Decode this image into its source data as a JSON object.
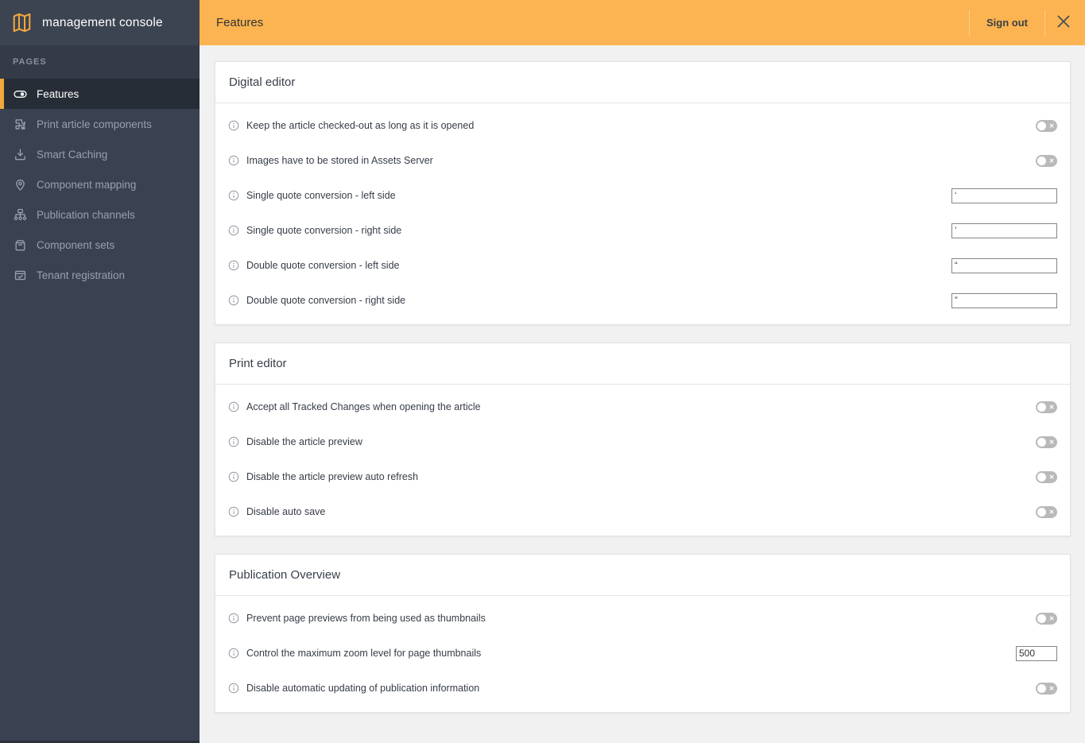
{
  "sidebar": {
    "logo_text": "management console",
    "section_label": "PAGES",
    "items": [
      {
        "label": "Features",
        "icon": "toggle-icon",
        "active": true
      },
      {
        "label": "Print article components",
        "icon": "puzzle-icon",
        "active": false
      },
      {
        "label": "Smart Caching",
        "icon": "download-icon",
        "active": false
      },
      {
        "label": "Component mapping",
        "icon": "map-pin-icon",
        "active": false
      },
      {
        "label": "Publication channels",
        "icon": "sitemap-icon",
        "active": false
      },
      {
        "label": "Component sets",
        "icon": "box-icon",
        "active": false
      },
      {
        "label": "Tenant registration",
        "icon": "server-check-icon",
        "active": false
      }
    ]
  },
  "header": {
    "title": "Features",
    "signout_label": "Sign out"
  },
  "colors": {
    "accent_orange": "#fbb451",
    "active_border_orange": "#f0a83d",
    "sidebar_bg": "#3a4150",
    "sidebar_active_bg": "#272d37",
    "toggle_off_gray": "#b9b9b9",
    "main_bg": "#f1f1f1"
  },
  "sections": [
    {
      "title": "Digital editor",
      "rows": [
        {
          "label": "Keep the article checked-out as long as it is opened",
          "control": "toggle",
          "state": "off"
        },
        {
          "label": "Images have to be stored in Assets Server",
          "control": "toggle",
          "state": "off"
        },
        {
          "label": "Single quote conversion - left side",
          "control": "text",
          "value": "‘"
        },
        {
          "label": "Single quote conversion - right side",
          "control": "text",
          "value": "’"
        },
        {
          "label": "Double quote conversion - left side",
          "control": "text",
          "value": "“"
        },
        {
          "label": "Double quote conversion - right side",
          "control": "text",
          "value": "”"
        }
      ]
    },
    {
      "title": "Print editor",
      "rows": [
        {
          "label": "Accept all Tracked Changes when opening the article",
          "control": "toggle",
          "state": "off"
        },
        {
          "label": "Disable the article preview",
          "control": "toggle",
          "state": "off"
        },
        {
          "label": "Disable the article preview auto refresh",
          "control": "toggle",
          "state": "off"
        },
        {
          "label": "Disable auto save",
          "control": "toggle",
          "state": "off"
        }
      ]
    },
    {
      "title": "Publication Overview",
      "rows": [
        {
          "label": "Prevent page previews from being used as thumbnails",
          "control": "toggle",
          "state": "off"
        },
        {
          "label": "Control the maximum zoom level for page thumbnails",
          "control": "number",
          "value": "500"
        },
        {
          "label": "Disable automatic updating of publication information",
          "control": "toggle",
          "state": "off"
        }
      ]
    }
  ]
}
